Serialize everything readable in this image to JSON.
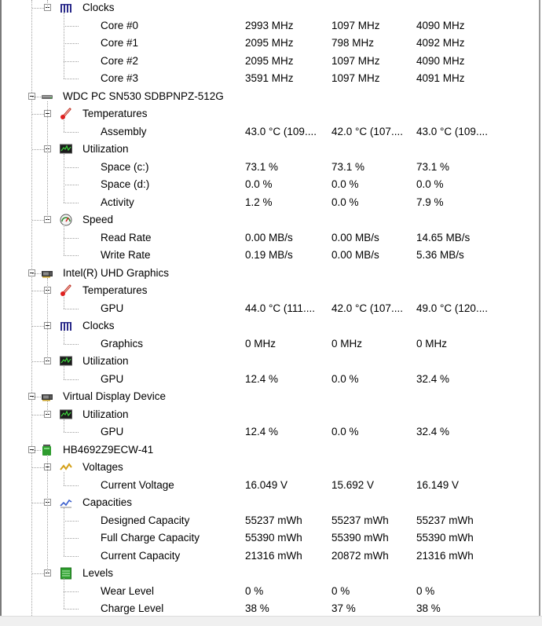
{
  "tree": [
    {
      "label": "Clocks",
      "level": 1,
      "icon": "clock-bars-icon",
      "expanded": true
    },
    {
      "label": "Core #0",
      "level": 2,
      "values": [
        "2993 MHz",
        "1097 MHz",
        "4090 MHz"
      ]
    },
    {
      "label": "Core #1",
      "level": 2,
      "values": [
        "2095 MHz",
        "798 MHz",
        "4092 MHz"
      ]
    },
    {
      "label": "Core #2",
      "level": 2,
      "values": [
        "2095 MHz",
        "1097 MHz",
        "4090 MHz"
      ]
    },
    {
      "label": "Core #3",
      "level": 2,
      "values": [
        "3591 MHz",
        "1097 MHz",
        "4091 MHz"
      ]
    },
    {
      "label": "WDC PC SN530 SDBPNPZ-512G",
      "level": 0,
      "icon": "drive-icon",
      "expanded": true
    },
    {
      "label": "Temperatures",
      "level": 1,
      "icon": "thermometer-icon",
      "expanded": true
    },
    {
      "label": "Assembly",
      "level": 2,
      "values": [
        "43.0 °C  (109....",
        "42.0 °C  (107....",
        "43.0 °C  (109...."
      ]
    },
    {
      "label": "Utilization",
      "level": 1,
      "icon": "monitor-graph-icon",
      "expanded": true
    },
    {
      "label": "Space (c:)",
      "level": 2,
      "values": [
        "73.1 %",
        "73.1 %",
        "73.1 %"
      ]
    },
    {
      "label": "Space (d:)",
      "level": 2,
      "values": [
        "0.0 %",
        "0.0 %",
        "0.0 %"
      ]
    },
    {
      "label": "Activity",
      "level": 2,
      "values": [
        "1.2 %",
        "0.0 %",
        "7.9 %"
      ]
    },
    {
      "label": "Speed",
      "level": 1,
      "icon": "gauge-icon",
      "expanded": true
    },
    {
      "label": "Read Rate",
      "level": 2,
      "values": [
        "0.00 MB/s",
        "0.00 MB/s",
        "14.65 MB/s"
      ]
    },
    {
      "label": "Write Rate",
      "level": 2,
      "values": [
        "0.19 MB/s",
        "0.00 MB/s",
        "5.36 MB/s"
      ]
    },
    {
      "label": "Intel(R) UHD Graphics",
      "level": 0,
      "icon": "graphics-card-icon",
      "expanded": true
    },
    {
      "label": "Temperatures",
      "level": 1,
      "icon": "thermometer-icon",
      "expanded": true
    },
    {
      "label": "GPU",
      "level": 2,
      "values": [
        "44.0 °C  (111....",
        "42.0 °C  (107....",
        "49.0 °C  (120...."
      ]
    },
    {
      "label": "Clocks",
      "level": 1,
      "icon": "clock-bars-icon",
      "expanded": true
    },
    {
      "label": "Graphics",
      "level": 2,
      "values": [
        "0 MHz",
        "0 MHz",
        "0 MHz"
      ]
    },
    {
      "label": "Utilization",
      "level": 1,
      "icon": "monitor-graph-icon",
      "expanded": true
    },
    {
      "label": "GPU",
      "level": 2,
      "values": [
        "12.4 %",
        "0.0 %",
        "32.4 %"
      ]
    },
    {
      "label": "Virtual Display Device",
      "level": 0,
      "icon": "graphics-card-icon",
      "expanded": true
    },
    {
      "label": "Utilization",
      "level": 1,
      "icon": "monitor-graph-icon",
      "expanded": true
    },
    {
      "label": "GPU",
      "level": 2,
      "values": [
        "12.4 %",
        "0.0 %",
        "32.4 %"
      ]
    },
    {
      "label": "HB4692Z9ECW-41",
      "level": 0,
      "icon": "battery-icon",
      "expanded": true
    },
    {
      "label": "Voltages",
      "level": 1,
      "icon": "voltage-icon",
      "expanded": true
    },
    {
      "label": "Current Voltage",
      "level": 2,
      "values": [
        "16.049 V",
        "15.692 V",
        "16.149 V"
      ]
    },
    {
      "label": "Capacities",
      "level": 1,
      "icon": "capacity-icon",
      "expanded": true
    },
    {
      "label": "Designed Capacity",
      "level": 2,
      "values": [
        "55237 mWh",
        "55237 mWh",
        "55237 mWh"
      ]
    },
    {
      "label": "Full Charge Capacity",
      "level": 2,
      "values": [
        "55390 mWh",
        "55390 mWh",
        "55390 mWh"
      ]
    },
    {
      "label": "Current Capacity",
      "level": 2,
      "values": [
        "21316 mWh",
        "20872 mWh",
        "21316 mWh"
      ]
    },
    {
      "label": "Levels",
      "level": 1,
      "icon": "levels-icon",
      "expanded": true
    },
    {
      "label": "Wear Level",
      "level": 2,
      "values": [
        "0 %",
        "0 %",
        "0 %"
      ]
    },
    {
      "label": "Charge Level",
      "level": 2,
      "values": [
        "38 %",
        "37 %",
        "38 %"
      ]
    }
  ]
}
